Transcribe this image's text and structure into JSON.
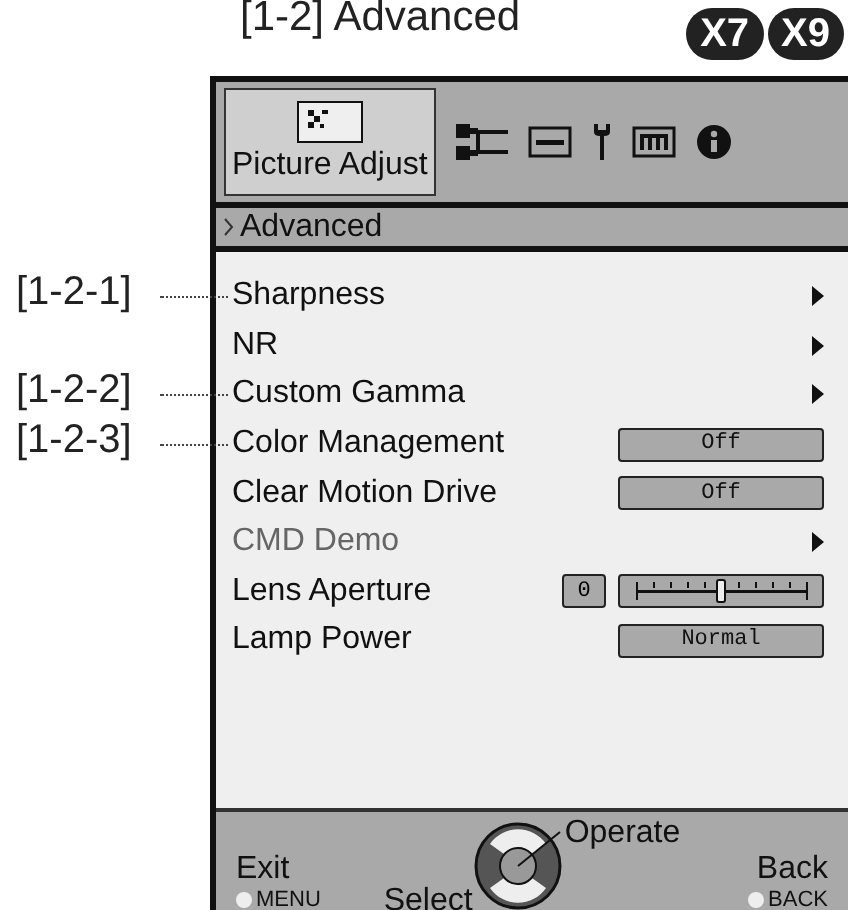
{
  "title": "[1-2] Advanced",
  "models": [
    "X7",
    "X9"
  ],
  "tabs": [
    {
      "kind": "picture",
      "label": "Picture Adjust",
      "selected": true
    },
    {
      "kind": "input",
      "selected": false
    },
    {
      "kind": "display",
      "selected": false
    },
    {
      "kind": "wrench",
      "selected": false
    },
    {
      "kind": "keyboard",
      "selected": false
    },
    {
      "kind": "info",
      "selected": false
    }
  ],
  "breadcrumb": "Advanced",
  "items": [
    {
      "kind": "submenu",
      "label": "Sharpness",
      "disabled": false,
      "callout": "[1-2-1]"
    },
    {
      "kind": "submenu",
      "label": "NR",
      "disabled": false
    },
    {
      "kind": "submenu",
      "label": "Custom Gamma",
      "disabled": false,
      "callout": "[1-2-2]"
    },
    {
      "kind": "value",
      "label": "Color Management",
      "value": "Off",
      "disabled": false,
      "callout": "[1-2-3]"
    },
    {
      "kind": "value",
      "label": "Clear Motion Drive",
      "value": "Off",
      "disabled": false
    },
    {
      "kind": "submenu",
      "label": "CMD Demo",
      "disabled": true
    },
    {
      "kind": "slider",
      "label": "Lens Aperture",
      "value": "0",
      "level": 0.5,
      "disabled": false
    },
    {
      "kind": "value",
      "label": "Lamp Power",
      "value": "Normal",
      "disabled": false
    }
  ],
  "footer": {
    "exit": "Exit",
    "exit_key": "MENU",
    "select": "Select",
    "operate": "Operate",
    "back": "Back",
    "back_key": "BACK"
  }
}
